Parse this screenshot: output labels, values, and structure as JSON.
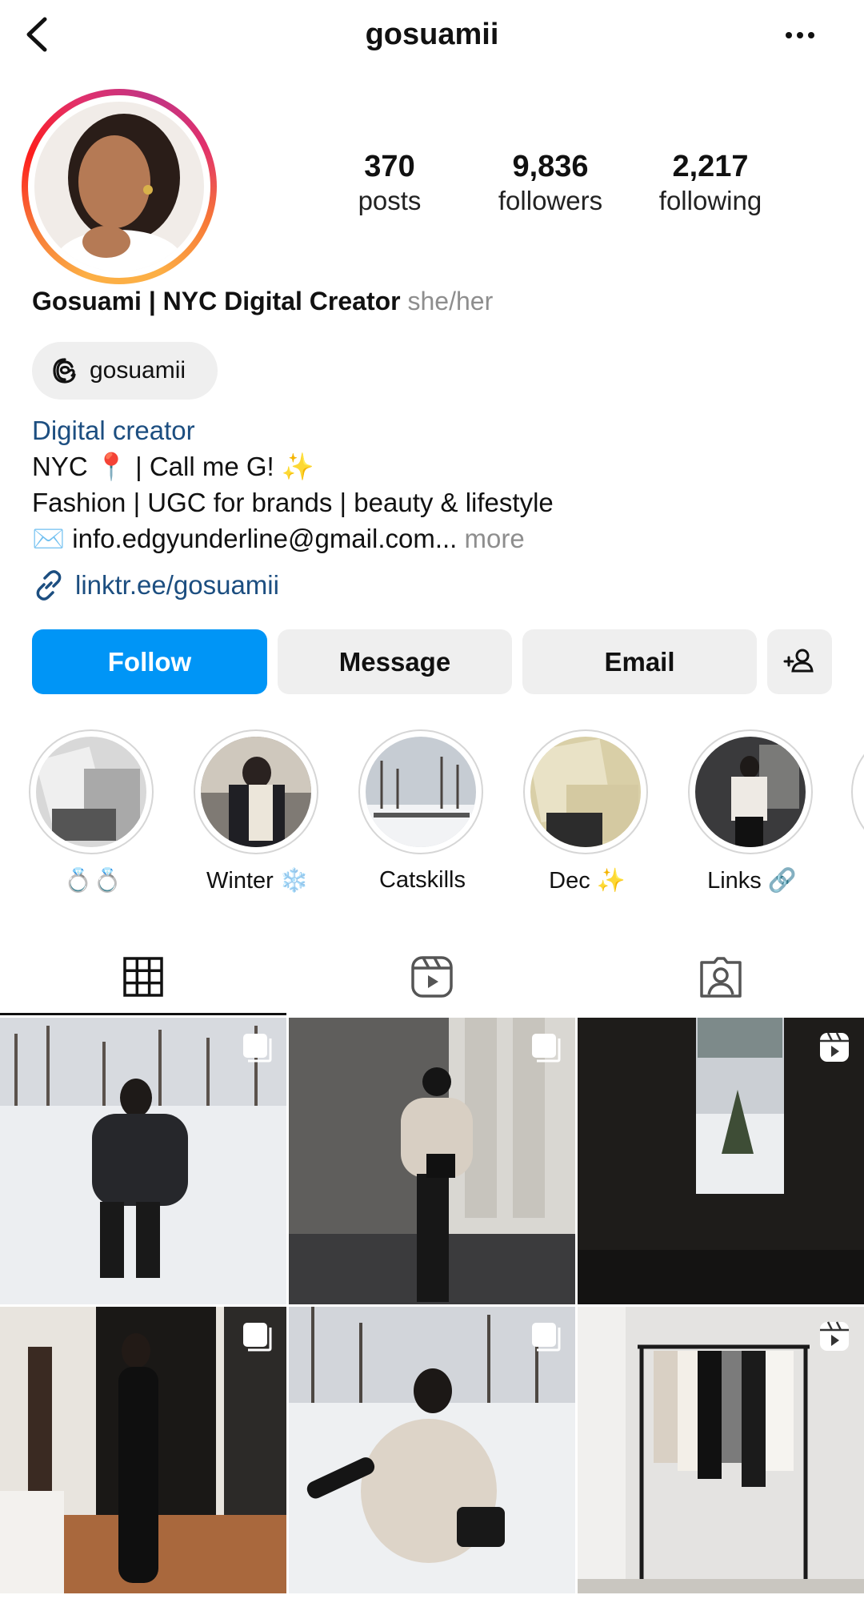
{
  "header": {
    "username": "gosuamii",
    "back_icon": "chevron-left-icon",
    "more_icon": "ellipsis-icon"
  },
  "stats": [
    {
      "value": "370",
      "label": "posts"
    },
    {
      "value": "9,836",
      "label": "followers"
    },
    {
      "value": "2,217",
      "label": "following"
    }
  ],
  "profile": {
    "full_name": "Gosuami | NYC Digital Creator",
    "pronouns": "she/her",
    "threads_handle": "gosuamii",
    "category": "Digital creator",
    "bio_line1": "NYC 📍 | Call me G! ✨",
    "bio_line2": "Fashion | UGC for brands | beauty & lifestyle",
    "bio_line3": "✉️ info.edgyunderline@gmail.com...",
    "more_label": "more",
    "link": "linktr.ee/gosuamii"
  },
  "actions": {
    "follow": "Follow",
    "message": "Message",
    "email": "Email",
    "add_user_icon": "add-user-icon"
  },
  "highlights": [
    {
      "label": "💍💍"
    },
    {
      "label": "Winter ❄️"
    },
    {
      "label": "Catskills"
    },
    {
      "label": "Dec ✨"
    },
    {
      "label": "Links 🔗"
    }
  ],
  "tabs": [
    {
      "icon": "grid-icon",
      "active": true
    },
    {
      "icon": "reels-icon",
      "active": false
    },
    {
      "icon": "tagged-icon",
      "active": false
    }
  ],
  "posts": [
    {
      "type": "carousel"
    },
    {
      "type": "carousel"
    },
    {
      "type": "reel"
    },
    {
      "type": "carousel"
    },
    {
      "type": "carousel"
    },
    {
      "type": "reel"
    }
  ],
  "colors": {
    "follow_blue": "#0095f6",
    "link_blue": "#1c4e80",
    "muted": "#8e8e8e"
  }
}
